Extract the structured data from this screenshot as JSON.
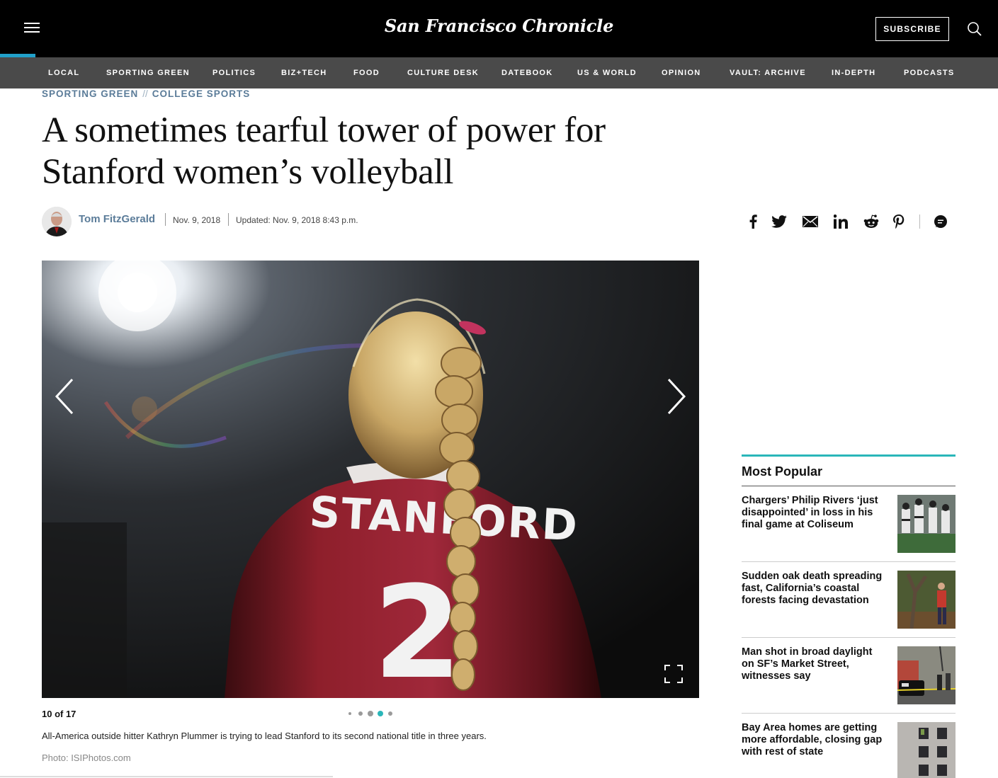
{
  "header": {
    "logo": "San Francisco Chronicle",
    "subscribe_label": "SUBSCRIBE",
    "menu_icon": "hamburger-menu-icon",
    "search_icon": "search-icon",
    "accent_color": "#21a0c9"
  },
  "nav": {
    "items": [
      {
        "label": "LOCAL"
      },
      {
        "label": "SPORTING GREEN"
      },
      {
        "label": "POLITICS"
      },
      {
        "label": "BIZ+TECH"
      },
      {
        "label": "FOOD"
      },
      {
        "label": "CULTURE DESK"
      },
      {
        "label": "DATEBOOK"
      },
      {
        "label": "US & WORLD"
      },
      {
        "label": "OPINION"
      },
      {
        "label": "VAULT: ARCHIVE"
      },
      {
        "label": "IN-DEPTH"
      },
      {
        "label": "PODCASTS"
      }
    ]
  },
  "article": {
    "breadcrumb": {
      "section": "SPORTING GREEN",
      "separator": "//",
      "subsection": "COLLEGE SPORTS"
    },
    "headline_line1": "A sometimes tearful tower of power for",
    "headline_line2": "Stanford women’s volleyball",
    "author": "Tom FitzGerald",
    "date": "Nov. 9, 2018",
    "updated": "Updated: Nov. 9, 2018 8:43 p.m.",
    "share_icons": [
      "facebook-icon",
      "twitter-icon",
      "email-icon",
      "linkedin-icon",
      "reddit-icon",
      "pinterest-icon",
      "comments-icon"
    ]
  },
  "gallery": {
    "jersey_text": "STANFORD",
    "jersey_number": "2",
    "counter": "10 of 17",
    "current_dot": 4,
    "dot_count": 5,
    "caption": "All-America outside hitter Kathryn Plummer is trying to lead Stanford to its second national title in three years.",
    "credit": "Photo: ISIPhotos.com"
  },
  "most_popular": {
    "title": "Most Popular",
    "rule_color": "#2ab6b9",
    "items": [
      {
        "headline": "Chargers’ Philip Rivers ‘just disappointed’ in loss in his final game at Coliseum"
      },
      {
        "headline": "Sudden oak death spreading fast, California’s coastal forests facing devastation"
      },
      {
        "headline": "Man shot in broad daylight on SF’s Market Street, witnesses say"
      },
      {
        "headline": "Bay Area homes are getting more affordable, closing gap with rest of state"
      }
    ]
  }
}
